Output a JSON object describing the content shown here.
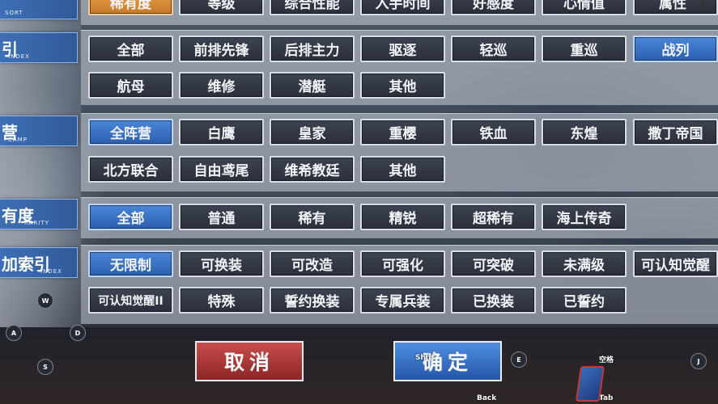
{
  "sections": {
    "sort": {
      "header_cn": "",
      "header_en": "SORT",
      "options": [
        "稀有度",
        "等级",
        "综合性能",
        "入手时间",
        "好感度",
        "心情值",
        "属性"
      ]
    },
    "index": {
      "header_cn": "引",
      "header_en": "INDEX",
      "options": [
        "全部",
        "前排先锋",
        "后排主力",
        "驱逐",
        "轻巡",
        "重巡",
        "战列",
        "航母",
        "维修",
        "潜艇",
        "其他"
      ]
    },
    "camp": {
      "header_cn": "营",
      "header_en": "CAMP",
      "options": [
        "全阵营",
        "白鹰",
        "皇家",
        "重樱",
        "铁血",
        "东煌",
        "撒丁帝国",
        "北方联合",
        "自由鸢尾",
        "维希教廷",
        "其他"
      ]
    },
    "rarity": {
      "header_cn": "有度",
      "header_en": "RARITY",
      "options": [
        "全部",
        "普通",
        "稀有",
        "精锐",
        "超稀有",
        "海上传奇"
      ]
    },
    "extra_index": {
      "header_cn": "加索引",
      "header_en": "INDEX",
      "options": [
        "无限制",
        "可换装",
        "可改造",
        "可强化",
        "可突破",
        "未满级",
        "可认知觉醒",
        "可认知觉醒II",
        "特殊",
        "誓约换装",
        "专属兵装",
        "已换装",
        "已誓约"
      ]
    }
  },
  "buttons": {
    "cancel": "取消",
    "confirm": "确定"
  },
  "key_hints": {
    "w": "W",
    "a": "A",
    "d": "D",
    "s": "S",
    "e": "E",
    "j": "J",
    "shift": "Shift",
    "space": "空格",
    "back": "Back",
    "tab": "Tab"
  },
  "colors": {
    "selected": "#3a74c8",
    "sort_selected": "#d68f3a",
    "cancel": "#a83232",
    "confirm": "#3572c6"
  }
}
